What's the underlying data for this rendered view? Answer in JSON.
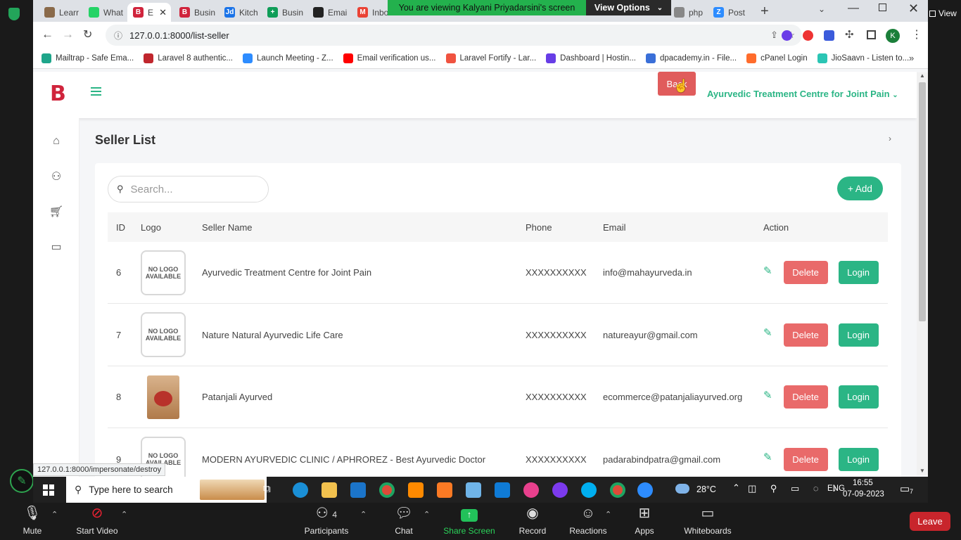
{
  "sharing_banner": {
    "text": "You are viewing Kalyani Priyadarsini's screen",
    "view_options": "View Options"
  },
  "zoom_view_label": "View",
  "browser": {
    "tabs": [
      {
        "label": "Learr",
        "color": "#8a6a4a",
        "glyph": ""
      },
      {
        "label": "What",
        "color": "#25d366",
        "glyph": ""
      },
      {
        "label": "E",
        "color": "#d0243c",
        "glyph": "B",
        "active": true
      },
      {
        "label": "Busin",
        "color": "#d0243c",
        "glyph": "B"
      },
      {
        "label": "Kitch",
        "color": "#1a73e8",
        "glyph": "Jd"
      },
      {
        "label": "Busin",
        "color": "#0f9d58",
        "glyph": "+"
      },
      {
        "label": "Emai",
        "color": "#222222",
        "glyph": ""
      },
      {
        "label": "Inbo",
        "color": "#ea4335",
        "glyph": "M"
      },
      {
        "label": "php",
        "color": "#888888",
        "glyph": ""
      },
      {
        "label": "Post",
        "color": "#2d8cff",
        "glyph": "Z"
      }
    ],
    "url": "127.0.0.1:8000/list-seller",
    "profile_initial": "K",
    "bookmarks": [
      {
        "label": "Mailtrap - Safe Ema...",
        "color": "#1ea58a"
      },
      {
        "label": "Laravel 8 authentic...",
        "color": "#c0262d"
      },
      {
        "label": "Launch Meeting - Z...",
        "color": "#2d8cff"
      },
      {
        "label": "Email verification us...",
        "color": "#ff0000"
      },
      {
        "label": "Laravel Fortify - Lar...",
        "color": "#f05340"
      },
      {
        "label": "Dashboard | Hostin...",
        "color": "#673de6"
      },
      {
        "label": "dpacademy.in - File...",
        "color": "#3a6fd8"
      },
      {
        "label": "cPanel Login",
        "color": "#ff6c2c"
      },
      {
        "label": "JioSaavn - Listen to...",
        "color": "#2bc5b4"
      }
    ],
    "status_url": "127.0.0.1:8000/impersonate/destroy"
  },
  "app": {
    "brand_letter": "B",
    "back_label": "Back",
    "user_dropdown": "Ayurvedic Treatment Centre for Joint Pain",
    "page_title": "Seller List",
    "search_placeholder": "Search...",
    "add_label": "+ Add",
    "columns": [
      "ID",
      "Logo",
      "Seller Name",
      "Phone",
      "Email",
      "Action"
    ],
    "delete_label": "Delete",
    "login_label": "Login",
    "no_logo_text": "NO LOGO AVAILABLE",
    "rows": [
      {
        "id": "6",
        "name": "Ayurvedic Treatment Centre for Joint Pain",
        "phone": "XXXXXXXXXX",
        "email": "info@mahayurveda.in",
        "logo": "none"
      },
      {
        "id": "7",
        "name": "Nature Natural Ayurvedic Life Care",
        "phone": "XXXXXXXXXX",
        "email": "natureayur@gmail.com",
        "logo": "none"
      },
      {
        "id": "8",
        "name": "Patanjali Ayurved",
        "phone": "XXXXXXXXXX",
        "email": "ecommerce@patanjaliayurved.org",
        "logo": "product"
      },
      {
        "id": "9",
        "name": "MODERN AYURVEDIC CLINIC / APHROREZ - Best Ayurvedic Doctor",
        "phone": "XXXXXXXXXX",
        "email": "padarabindpatra@gmail.com",
        "logo": "none"
      }
    ]
  },
  "taskbar": {
    "search_placeholder": "Type here to search",
    "weather": "28°C",
    "language": "ENG",
    "time": "16:55",
    "date": "07-09-2023",
    "notification_count": "7"
  },
  "zoom": {
    "mute": "Mute",
    "start_video": "Start Video",
    "participants": "Participants",
    "participants_count": "4",
    "chat": "Chat",
    "share_screen": "Share Screen",
    "record": "Record",
    "reactions": "Reactions",
    "apps": "Apps",
    "whiteboards": "Whiteboards",
    "leave": "Leave"
  }
}
